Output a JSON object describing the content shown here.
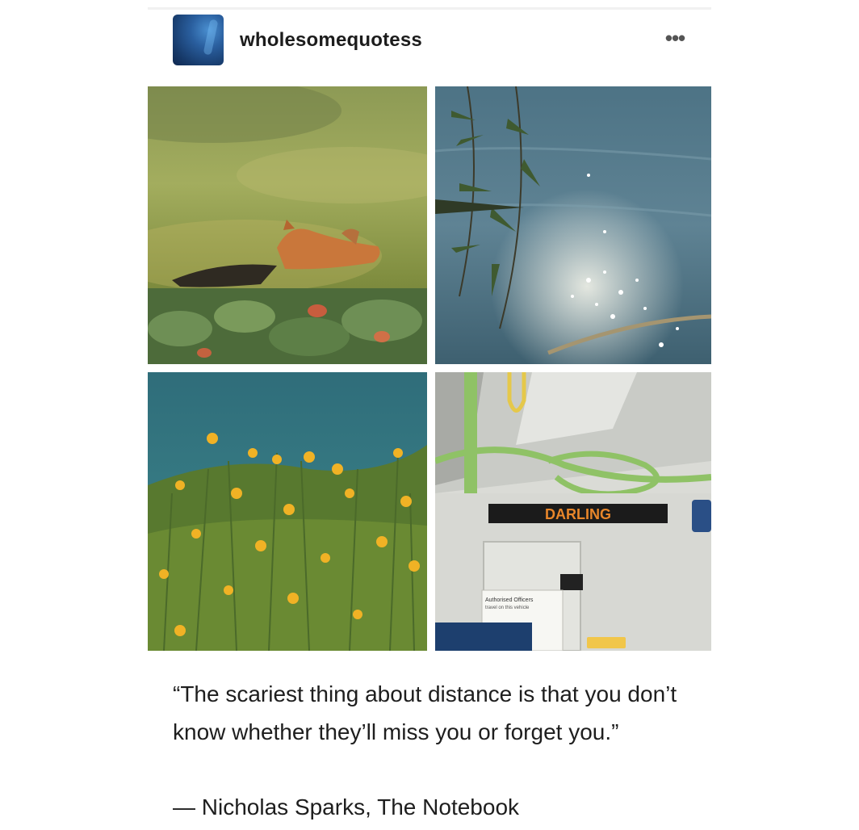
{
  "post": {
    "username": "wholesomequotess",
    "more_icon": "ellipsis-icon",
    "more_glyph": "•••",
    "photos": [
      {
        "alt": "cat-lying-in-grass"
      },
      {
        "alt": "willow-over-sparkling-water"
      },
      {
        "alt": "yellow-flowers-by-sea"
      },
      {
        "alt": "train-interior-darling-sign",
        "sign_text": "DARLING",
        "notice_title": "Authorised Officers",
        "notice_sub": "travel on this vehicle"
      }
    ],
    "quote": "“The scariest thing about distance is that you don’t know whether they’ll miss you or forget you.”",
    "attribution": "— Nicholas Sparks, The Notebook"
  },
  "colors": {
    "text": "#1e1e1e",
    "sign_amber": "#e8862a",
    "train_pole": "#8fc266"
  }
}
